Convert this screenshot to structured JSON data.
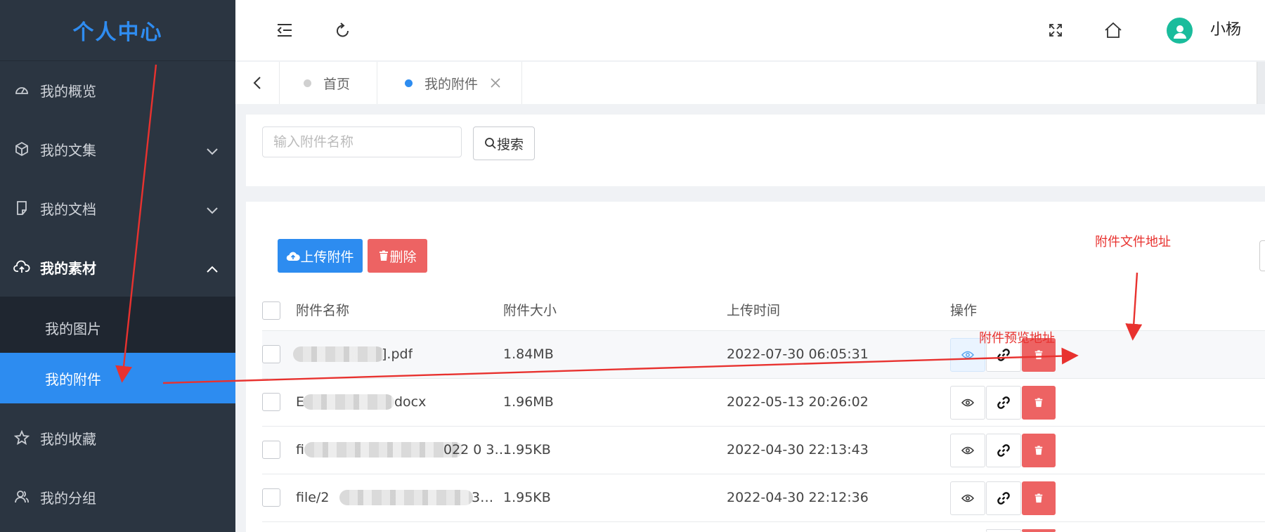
{
  "sidebar": {
    "title": "个人中心",
    "items": [
      {
        "label": "我的概览",
        "icon": "dashboard-icon"
      },
      {
        "label": "我的文集",
        "icon": "cube-icon",
        "expand": "collapsed"
      },
      {
        "label": "我的文档",
        "icon": "document-icon",
        "expand": "collapsed"
      },
      {
        "label": "我的素材",
        "icon": "cloud-upload-icon",
        "expand": "expanded"
      },
      {
        "label": "我的收藏",
        "icon": "star-icon"
      },
      {
        "label": "我的分组",
        "icon": "users-icon"
      }
    ],
    "subitems": [
      {
        "label": "我的图片",
        "active": false
      },
      {
        "label": "我的附件",
        "active": true
      }
    ]
  },
  "header": {
    "user_name": "小杨",
    "icons": [
      "menu-fold-icon",
      "refresh-icon",
      "fullscreen-icon",
      "home-icon",
      "avatar"
    ]
  },
  "tabs": [
    {
      "label": "首页",
      "active": false
    },
    {
      "label": "我的附件",
      "active": true,
      "closable": true
    }
  ],
  "search": {
    "placeholder": "输入附件名称",
    "value": "",
    "button_label": "搜索"
  },
  "toolbar": {
    "upload_label": "上传附件",
    "delete_label": "删除"
  },
  "table": {
    "headers": [
      "附件名称",
      "附件大小",
      "上传时间",
      "操作"
    ],
    "rows": [
      {
        "name_visible": "].pdf",
        "size": "1.84MB",
        "time": "2022-07-30 06:05:31"
      },
      {
        "name_visible": "E",
        "name_suffix": "docx",
        "size": "1.96MB",
        "time": "2022-05-13 20:26:02"
      },
      {
        "name_visible": "fi",
        "name_suffix": "022 0 3…",
        "size": "1.95KB",
        "time": "2022-04-30 22:13:43"
      },
      {
        "name_visible": "file/2",
        "name_suffix": "3…",
        "size": "1.95KB",
        "time": "2022-04-30 22:12:36"
      }
    ]
  },
  "annotations": {
    "link_label": "附件文件地址",
    "preview_label": "附件预览地址"
  },
  "colors": {
    "sidebar_bg": "#2b3541",
    "accent": "#2d8cf0",
    "danger": "#ed6363",
    "annotation": "#e8322f"
  }
}
